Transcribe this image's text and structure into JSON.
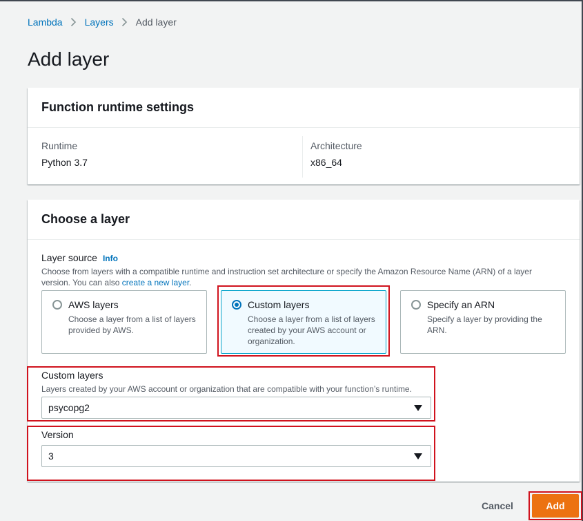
{
  "breadcrumb": {
    "items": [
      {
        "label": "Lambda"
      },
      {
        "label": "Layers"
      },
      {
        "label": "Add layer"
      }
    ]
  },
  "page": {
    "title": "Add layer"
  },
  "runtime_settings": {
    "title": "Function runtime settings",
    "runtime_label": "Runtime",
    "runtime_value": "Python 3.7",
    "architecture_label": "Architecture",
    "architecture_value": "x86_64"
  },
  "choose_layer": {
    "title": "Choose a layer",
    "source_label": "Layer source",
    "info_label": "Info",
    "source_description": "Choose from layers with a compatible runtime and instruction set architecture or specify the Amazon Resource Name (ARN) of a layer version. You can also",
    "source_link": "create a new layer",
    "source_description_end": ".",
    "options": [
      {
        "title": "AWS layers",
        "description": "Choose a layer from a list of layers provided by AWS.",
        "selected": false
      },
      {
        "title": "Custom layers",
        "description": "Choose a layer from a list of layers created by your AWS account or organization.",
        "selected": true
      },
      {
        "title": "Specify an ARN",
        "description": "Specify a layer by providing the ARN.",
        "selected": false
      }
    ],
    "custom_layers": {
      "label": "Custom layers",
      "description": "Layers created by your AWS account or organization that are compatible with your function’s runtime.",
      "value": "psycopg2"
    },
    "version": {
      "label": "Version",
      "value": "3"
    }
  },
  "actions": {
    "cancel_label": "Cancel",
    "add_label": "Add"
  },
  "colors": {
    "link": "#0073bb",
    "primary_button": "#ec7211",
    "highlight": "#d0121d",
    "selected_tile_bg": "#f1faff"
  }
}
